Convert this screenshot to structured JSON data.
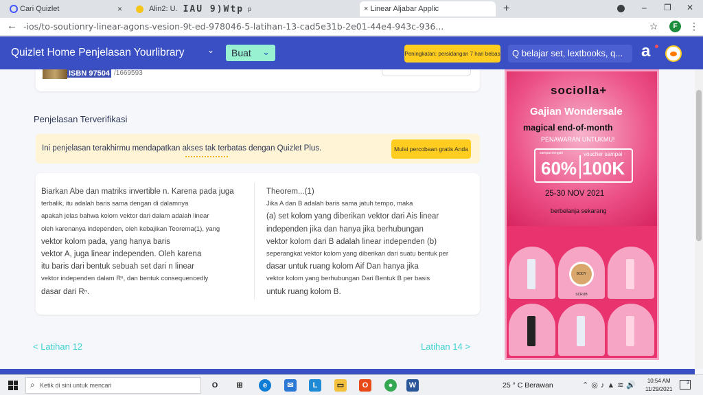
{
  "browser": {
    "tabs": [
      {
        "title": "Cari Quizlet",
        "close": "×"
      },
      {
        "title": "Alin2: U.",
        "glitch": "IAU 9)Wtp",
        "suffix": "p",
        "close": ""
      },
      {
        "title": "× Linear Aljabar Applic",
        "close": "×"
      }
    ],
    "new_tab": "+",
    "window_controls": [
      "–",
      "❐",
      "✕"
    ],
    "url": "-ios/to-soutionry-linear-agons-vesion-9t-ed-978046-5-latihan-13-cad5e31b-2e01-44e4-943c-936...",
    "profile_initial": "F"
  },
  "header": {
    "nav_text": "Quizlet Home Penjelasan Yourlibrary",
    "create_label": "Buat",
    "upgrade_label": "Peningkatan: persidangan 7 hari bebas",
    "search_placeholder": "Q belajar set, lextbooks, q...",
    "brand_letter": "a"
  },
  "book": {
    "isbn_label": "ISBN 97504",
    "isbn_rest": "/1669593"
  },
  "section_title": "Penjelasan Terverifikasi",
  "plus_banner": {
    "text": "Ini penjelasan terakhirmu mendapatkan akses tak terbatas dengan Quizlet Plus.",
    "button": "Mulai percobaan gratis Anda"
  },
  "solution": {
    "left": [
      {
        "t": "Biarkan Abe dan matriks invertible n. Karena pada juga",
        "s": false
      },
      {
        "t": "terbalik, itu adalah baris sama dengan di dalamnya",
        "s": true
      },
      {
        "t": "apakah jelas bahwa kolom vektor dari dalam adalah linear",
        "s": true
      },
      {
        "t": "oleh karenanya independen, oleh kebajikan Teorema(1), yang",
        "s": true
      },
      {
        "t": "vektor kolom pada, yang hanya baris",
        "s": false
      },
      {
        "t": "vektor A, juga linear independen. Oleh karena",
        "s": false
      },
      {
        "t": "itu baris dari bentuk sebuah set dari n linear",
        "s": false
      },
      {
        "t": "vektor independen dalam Rⁿ, dan bentuk consequencedly",
        "s": true
      },
      {
        "t": "dasar dari Rⁿ.",
        "s": false
      }
    ],
    "right": [
      {
        "t": "Theorem...(1)",
        "s": false
      },
      {
        "t": "Jika A dan B adalah baris sama jatuh tempo, maka",
        "s": true
      },
      {
        "t": "(a) set kolom yang diberikan vektor dari Ais linear",
        "s": false
      },
      {
        "t": "independen jika dan hanya jika berhubungan",
        "s": false
      },
      {
        "t": "vektor kolom dari B adalah linear independen (b)",
        "s": false
      },
      {
        "t": "seperangkat vektor kolom yang diberikan dari suatu bentuk per",
        "s": true
      },
      {
        "t": "dasar untuk ruang kolom Aif Dan hanya jika",
        "s": false
      },
      {
        "t": "vektor kolom yang berhubungan Dari Bentuk B per basis",
        "s": true
      },
      {
        "t": "untuk ruang kolom B.",
        "s": false
      }
    ]
  },
  "pager": {
    "prev": "< Latihan 12",
    "next": "Latihan 14 >"
  },
  "ad": {
    "brand": "sociolla+",
    "headline": "Gajian Wondersale",
    "sub": "magical end-of-month",
    "sub2": "PENAWARAN UNTUKMU!",
    "mini": "sampai dengan",
    "pct": "60%",
    "voucher_label": "voucher sampai",
    "voucher_value": "100K",
    "dates": "25-30 NOV 2021",
    "cta": "berbelanja sekarang",
    "jar_label": "BODY SCRUB"
  },
  "taskbar": {
    "search_placeholder": "Ketik di sini untuk mencari",
    "weather": "25 ° C Berawan",
    "time": "10:54 AM",
    "date": "11/29/2021",
    "notifications": "3"
  },
  "colors": {
    "header_bg": "#3b4fc4",
    "create_btn": "#98f1d1",
    "upgrade_btn": "#ffcd1f",
    "link": "#3ccfcf",
    "ad_bg": "#e8336f"
  }
}
